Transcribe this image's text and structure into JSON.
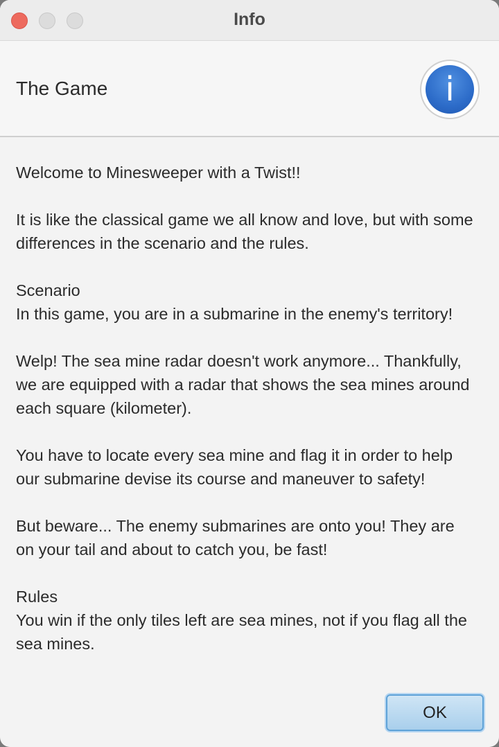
{
  "window": {
    "title": "Info"
  },
  "header": {
    "text": "The Game",
    "icon": "info-icon",
    "icon_glyph": "i"
  },
  "content": {
    "paragraphs": [
      [
        "Welcome to Minesweeper with a Twist!!"
      ],
      [
        "It is like the classical game we all know and love, but with some",
        "differences in the scenario and the rules."
      ],
      [
        "Scenario",
        "In this game, you are in a submarine in the enemy's territory!"
      ],
      [
        "Welp! The sea mine radar doesn't work anymore... Thankfully,",
        "we are equipped with a radar that shows the sea mines around",
        "each square (kilometer)."
      ],
      [
        "You have to locate every sea mine and flag it in order to help",
        "our submarine devise its course and maneuver to safety!"
      ],
      [
        "But beware... The enemy submarines are onto you! They are",
        "on your tail and about to catch you, be fast!"
      ],
      [
        "Rules",
        "You win if the only tiles left are sea mines, not if you flag all the",
        "sea mines."
      ]
    ]
  },
  "buttons": {
    "ok": "OK"
  },
  "colors": {
    "close_button": "#ed6a5e",
    "info_icon": "#2d6cc9",
    "ok_border": "#5ea2d8"
  }
}
